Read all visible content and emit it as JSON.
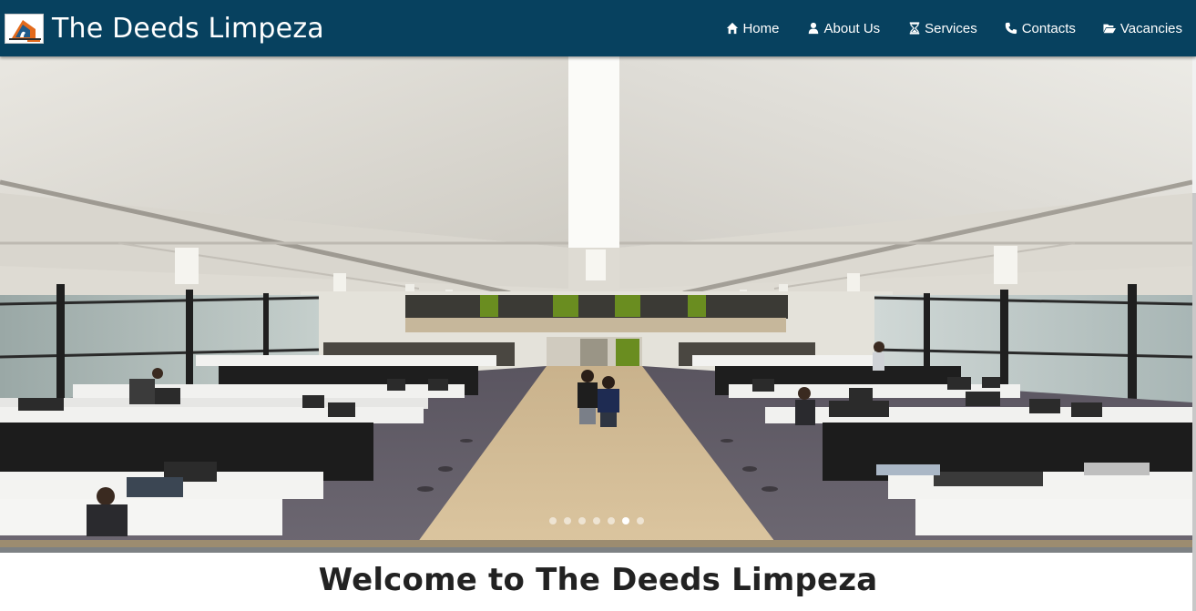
{
  "site": {
    "title": "The Deeds Limpeza"
  },
  "nav": {
    "items": [
      {
        "label": "Home",
        "icon": "home-icon"
      },
      {
        "label": "About Us",
        "icon": "user-icon"
      },
      {
        "label": "Services",
        "icon": "hourglass-icon"
      },
      {
        "label": "Contacts",
        "icon": "phone-icon"
      },
      {
        "label": "Vacancies",
        "icon": "folder-open-icon"
      }
    ]
  },
  "carousel": {
    "slide_count": 7,
    "active_index": 5,
    "image_subject": "open-plan office with white desks and a high white ceiling"
  },
  "welcome": {
    "heading": "Welcome to The Deeds Limpeza"
  },
  "colors": {
    "navbar": "#07415f",
    "text_light": "#ffffff",
    "heading": "#222222"
  }
}
